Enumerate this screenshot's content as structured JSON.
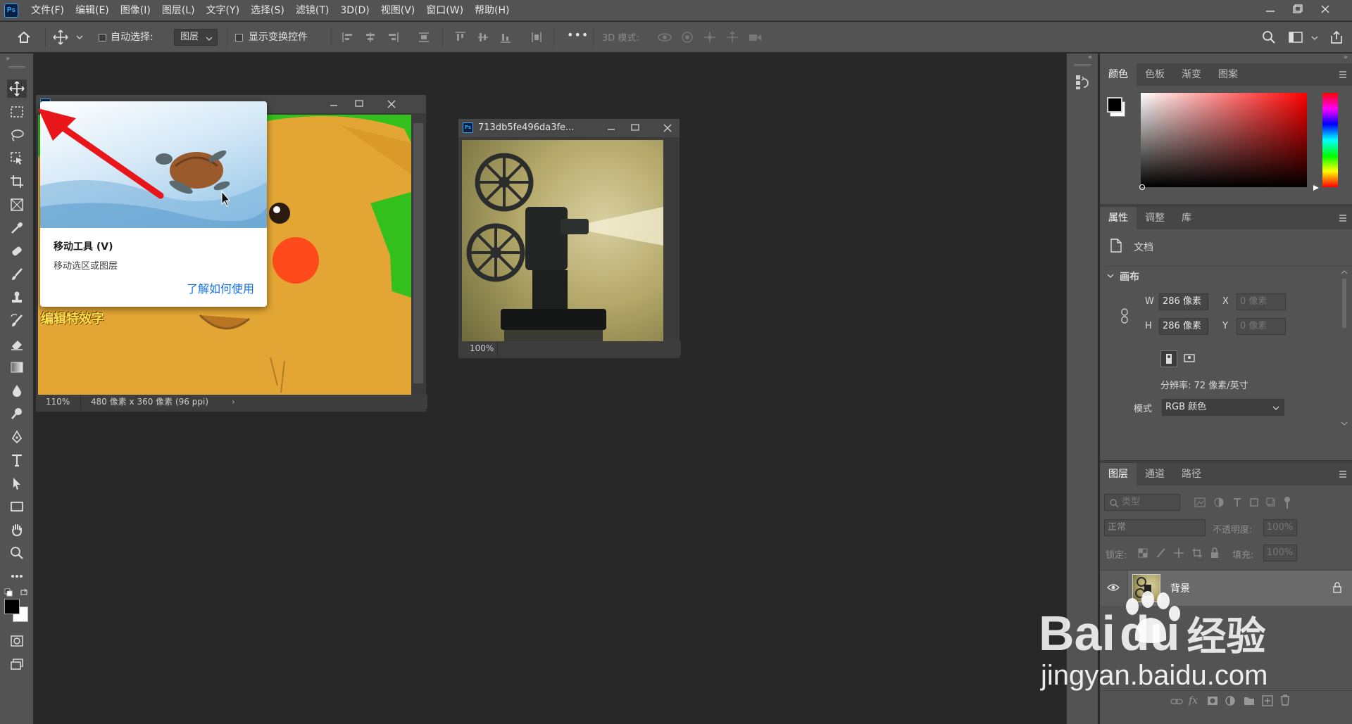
{
  "app": {
    "logo": "Ps"
  },
  "menu": [
    "文件(F)",
    "编辑(E)",
    "图像(I)",
    "图层(L)",
    "文字(Y)",
    "选择(S)",
    "滤镜(T)",
    "3D(D)",
    "视图(V)",
    "窗口(W)",
    "帮助(H)"
  ],
  "options": {
    "auto_select_label": "自动选择:",
    "auto_select_value": "图层",
    "show_transform_label": "显示变换控件",
    "three_d_mode_label": "3D 模式:",
    "more": "•••"
  },
  "doc1": {
    "zoom": "110%",
    "info": "480 像素 x 360 像素 (96 ppi)",
    "overlay_text": "编辑特效字"
  },
  "doc2": {
    "title": "713db5fe496da3fe...",
    "zoom": "100%"
  },
  "tooltip": {
    "title": "移动工具 (V)",
    "description": "移动选区或图层",
    "link": "了解如何使用"
  },
  "color_panel": {
    "tabs": [
      "颜色",
      "色板",
      "渐变",
      "图案"
    ],
    "active": "颜色"
  },
  "properties": {
    "tabs": [
      "属性",
      "调整",
      "库"
    ],
    "doc_label": "文档",
    "canvas_label": "画布",
    "w_label": "W",
    "w_value": "286 像素",
    "h_label": "H",
    "h_value": "286 像素",
    "x_label": "X",
    "x_value": "0 像素",
    "y_label": "Y",
    "y_value": "0 像素",
    "resolution": "分辨率: 72 像素/英寸",
    "mode_label": "模式",
    "mode_value": "RGB 颜色"
  },
  "layers": {
    "tabs": [
      "图层",
      "通道",
      "路径"
    ],
    "filter_placeholder": "类型",
    "blend_mode": "正常",
    "opacity_label": "不透明度:",
    "opacity_value": "100%",
    "lock_label": "锁定:",
    "fill_label": "填充:",
    "fill_value": "100%",
    "layer_name": "背景"
  },
  "watermark": {
    "brand": "Bai",
    "brand2": "du",
    "brand3": "经验",
    "url": "jingyan.baidu.com"
  },
  "colors": {
    "accent": "#1473e6",
    "red_arrow": "#e8161b",
    "green_screen": "#34c01c"
  }
}
